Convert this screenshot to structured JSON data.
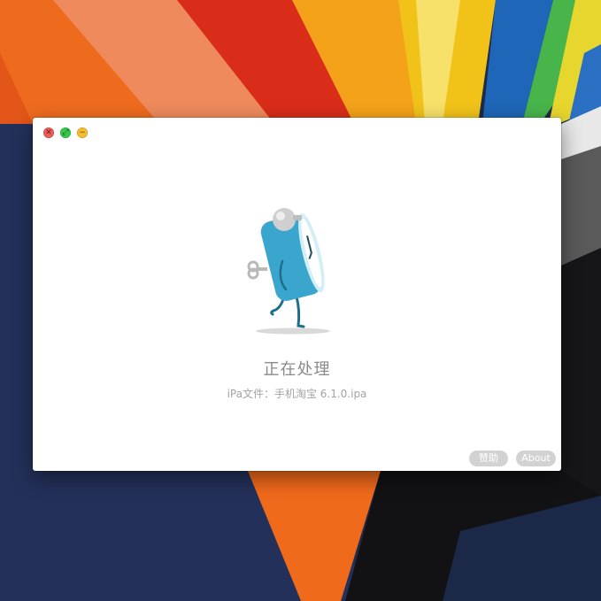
{
  "window": {
    "controls": {
      "close_icon": "close-icon",
      "zoom_icon": "zoom-icon",
      "minimize_icon": "minimize-icon"
    },
    "status": "正在处理",
    "file_info": "iPa文件：手机淘宝 6.1.0.ipa",
    "buttons": {
      "sponsor": "赞助",
      "about": "About"
    }
  },
  "colors": {
    "close": "#ec5b57",
    "zoom": "#34c84a",
    "minimize": "#f5bc2f",
    "mascot_body": "#3aa6cd",
    "button_bg": "#d2d2d2"
  }
}
